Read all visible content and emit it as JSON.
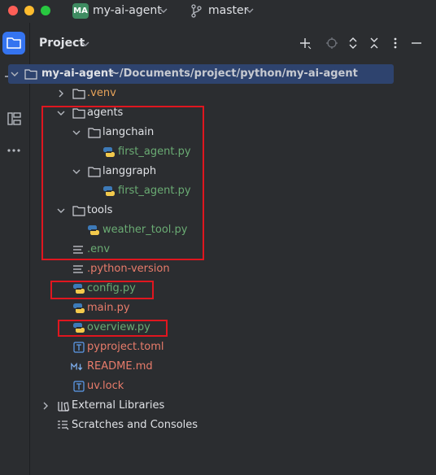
{
  "titlebar": {
    "project_badge": "MA",
    "project_name": "my-ai-agent",
    "branch_name": "master"
  },
  "panel": {
    "title": "Project"
  },
  "tree": {
    "root_name": "my-ai-agent",
    "root_path": "~/Documents/project/python/my-ai-agent",
    "venv": ".venv",
    "agents": "agents",
    "langchain": "langchain",
    "langchain_file": "first_agent.py",
    "langgraph": "langgraph",
    "langgraph_file": "first_agent.py",
    "tools": "tools",
    "weather_tool": "weather_tool.py",
    "env": ".env",
    "python_version": ".python-version",
    "config": "config.py",
    "main": "main.py",
    "overview": "overview.py",
    "pyproject": "pyproject.toml",
    "readme": "README.md",
    "uvlock": "uv.lock",
    "external_libraries": "External Libraries",
    "scratches": "Scratches and Consoles"
  },
  "colors": {
    "accent": "#3574f0",
    "selection": "#2e436e",
    "highlight_box": "#e0161f",
    "modified_green": "#6aab73",
    "unversioned_red": "#e87c6b"
  }
}
